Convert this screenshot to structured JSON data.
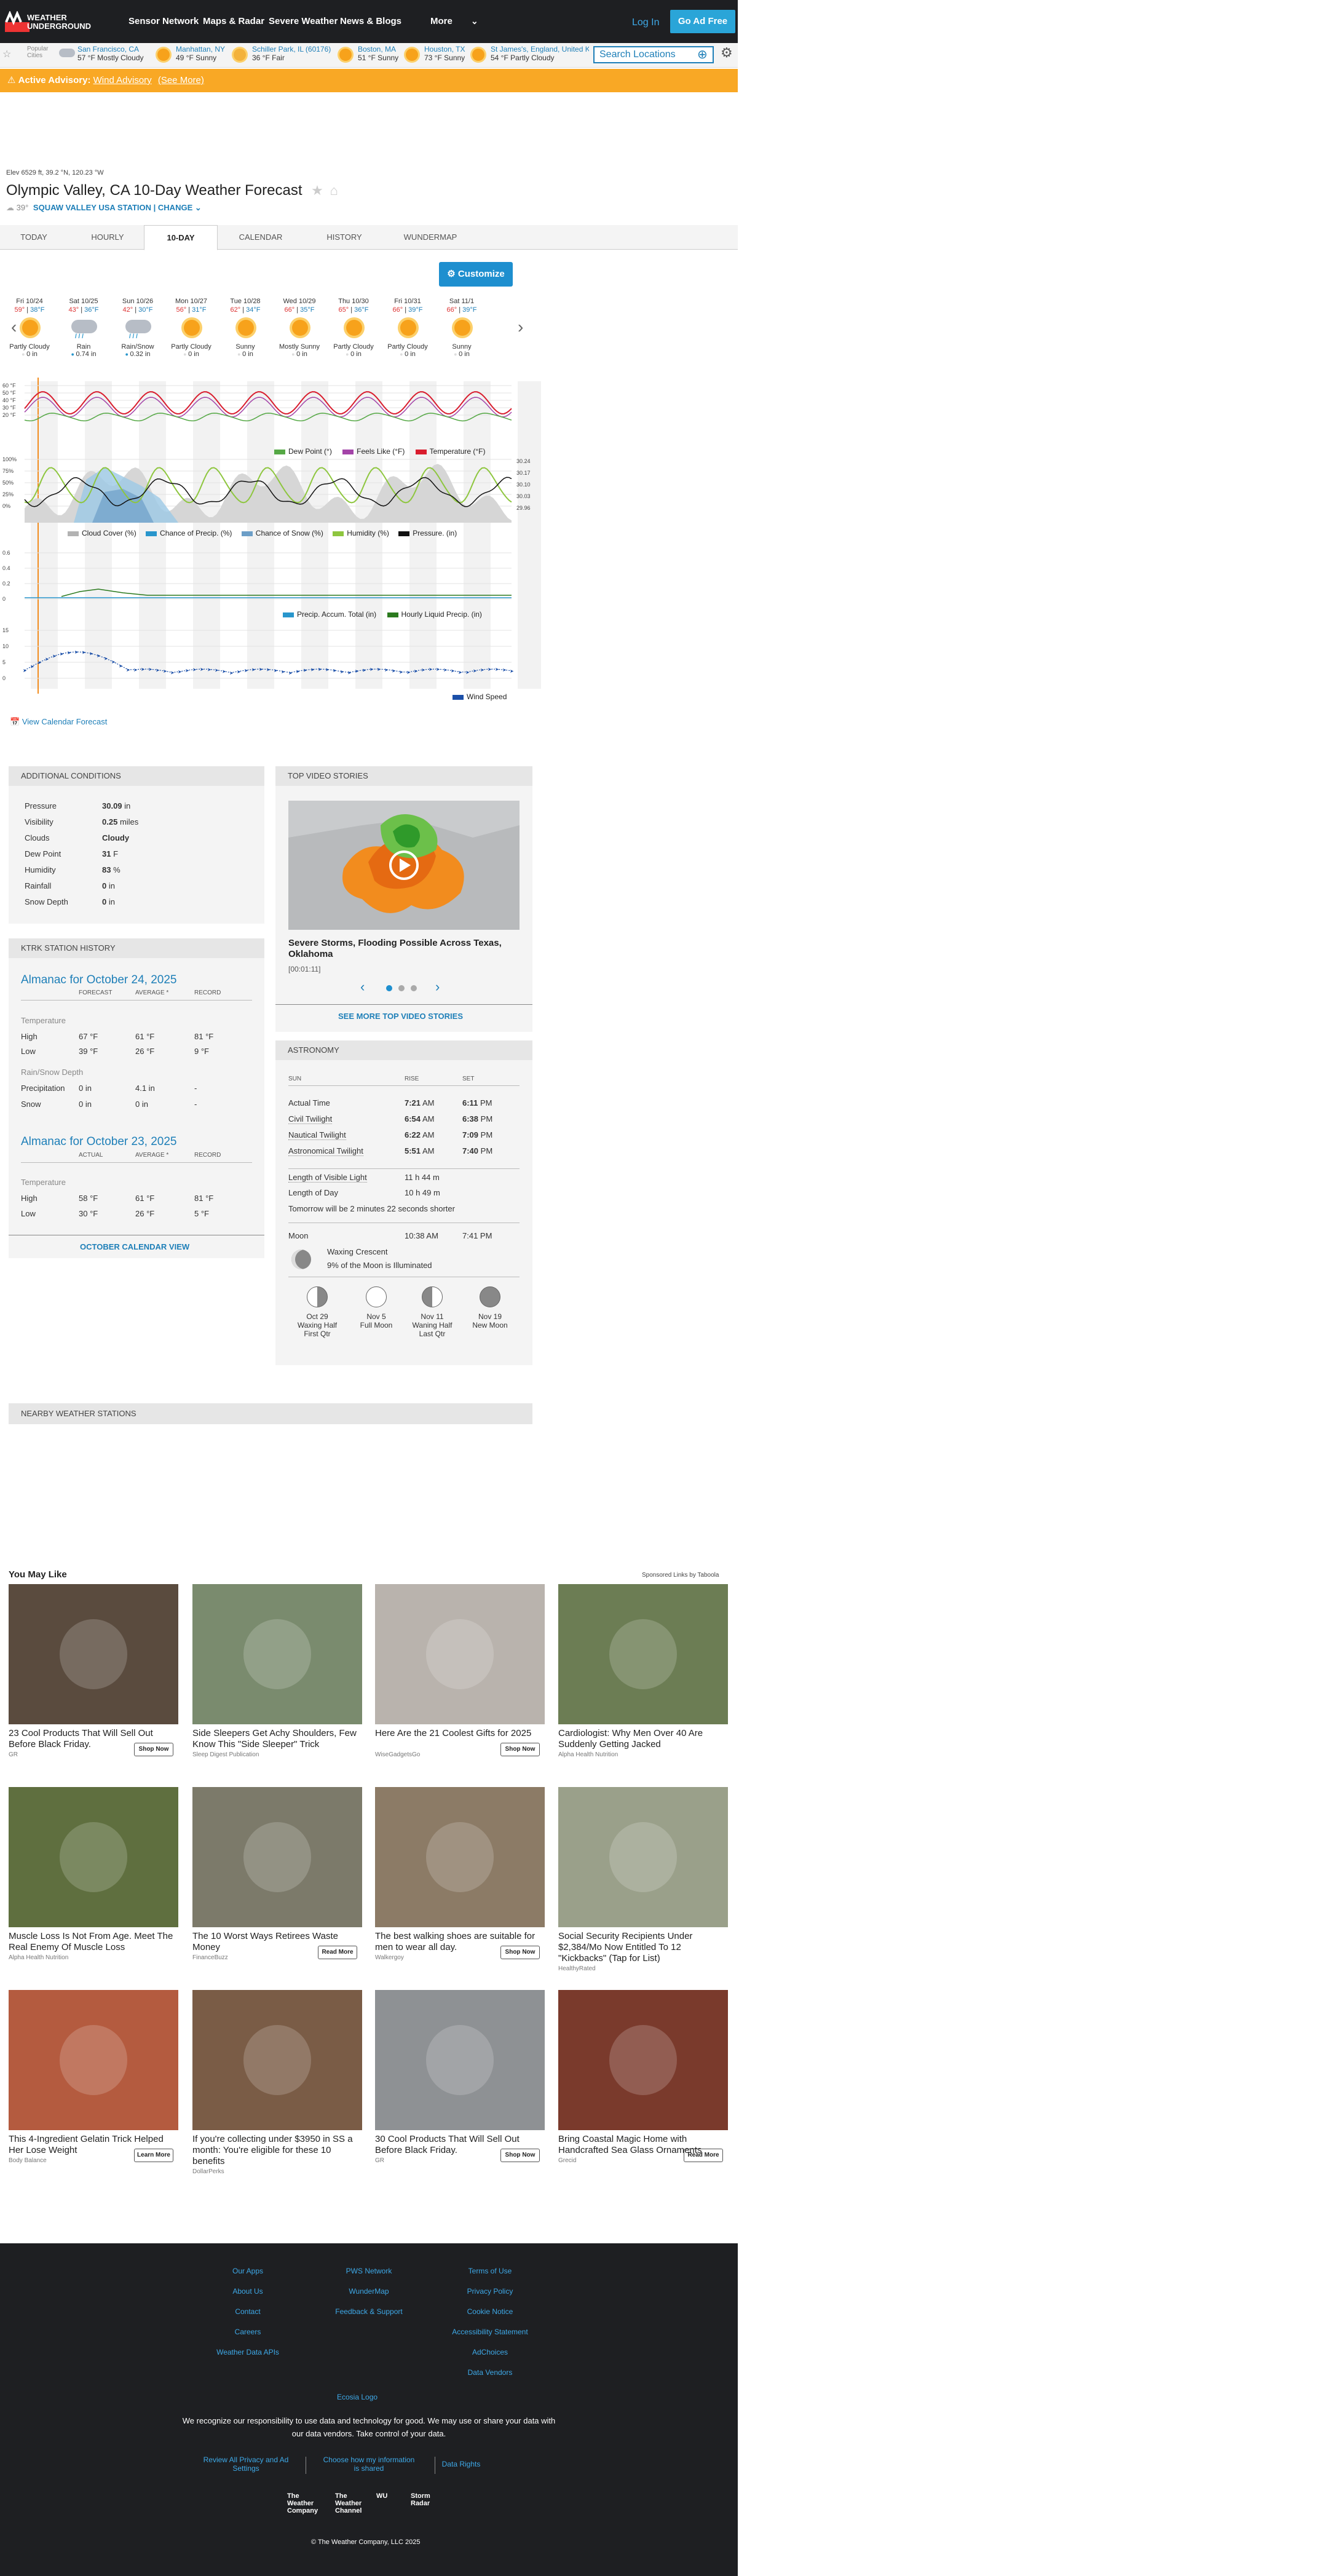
{
  "header": {
    "logo_text_1": "WEATHER",
    "logo_text_2": "UNDERGROUND",
    "nav": [
      "Sensor Network",
      "Maps & Radar",
      "Severe Weather",
      "News & Blogs",
      "More"
    ],
    "login": "Log In",
    "adfree": "Go Ad Free"
  },
  "citybar": {
    "label": "Popular Cities",
    "cities": [
      {
        "name": "San Francisco, CA",
        "temp": "57 °F Mostly Cloudy"
      },
      {
        "name": "Manhattan, NY",
        "temp": "49 °F Sunny"
      },
      {
        "name": "Schiller Park, IL (60176)",
        "temp": "36 °F Fair"
      },
      {
        "name": "Boston, MA",
        "temp": "51 °F Sunny"
      },
      {
        "name": "Houston, TX",
        "temp": "73 °F Sunny"
      },
      {
        "name": "St James's, England, United K",
        "temp": "54 °F Partly Cloudy"
      }
    ],
    "search_placeholder": "Search Locations"
  },
  "advisory": {
    "label": "Active Advisory:",
    "link": "Wind Advisory",
    "more": "(See More)"
  },
  "location": {
    "elevation": "Elev 6529 ft, 39.2 °N, 120.23 °W",
    "title": "Olympic Valley, CA 10-Day Weather Forecast",
    "current_temp": "39°",
    "station": "SQUAW VALLEY USA STATION | CHANGE"
  },
  "tabs": [
    "TODAY",
    "HOURLY",
    "10-DAY",
    "CALENDAR",
    "HISTORY",
    "WUNDERMAP"
  ],
  "customize": "Customize",
  "forecast": [
    {
      "day": "Fri 10/24",
      "hi": "59°",
      "lo": "38°F",
      "cond": "Partly Cloudy",
      "precip": "0 in",
      "icon": "sun"
    },
    {
      "day": "Sat 10/25",
      "hi": "43°",
      "lo": "36°F",
      "cond": "Rain",
      "precip": "0.74 in",
      "icon": "rain"
    },
    {
      "day": "Sun 10/26",
      "hi": "42°",
      "lo": "30°F",
      "cond": "Rain/Snow",
      "precip": "0.32 in",
      "icon": "rain"
    },
    {
      "day": "Mon 10/27",
      "hi": "56°",
      "lo": "31°F",
      "cond": "Partly Cloudy",
      "precip": "0 in",
      "icon": "sun"
    },
    {
      "day": "Tue 10/28",
      "hi": "62°",
      "lo": "34°F",
      "cond": "Sunny",
      "precip": "0 in",
      "icon": "sun"
    },
    {
      "day": "Wed 10/29",
      "hi": "66°",
      "lo": "35°F",
      "cond": "Mostly Sunny",
      "precip": "0 in",
      "icon": "sun"
    },
    {
      "day": "Thu 10/30",
      "hi": "65°",
      "lo": "36°F",
      "cond": "Partly Cloudy",
      "precip": "0 in",
      "icon": "sun"
    },
    {
      "day": "Fri 10/31",
      "hi": "66°",
      "lo": "39°F",
      "cond": "Partly Cloudy",
      "precip": "0 in",
      "icon": "sun"
    },
    {
      "day": "Sat 11/1",
      "hi": "66°",
      "lo": "39°F",
      "cond": "Sunny",
      "precip": "0 in",
      "icon": "sun"
    }
  ],
  "charts": {
    "temp_axis": [
      "60 °F",
      "50 °F",
      "40 °F",
      "30 °F",
      "20 °F"
    ],
    "legend1": [
      "Dew Point (°)",
      "Feels Like (°F)",
      "Temperature (°F)"
    ],
    "pct_axis": [
      "100%",
      "75%",
      "50%",
      "25%",
      "0%"
    ],
    "pressure_axis": [
      "30.24",
      "30.17",
      "30.10",
      "30.03",
      "29.96"
    ],
    "legend2": [
      "Cloud Cover (%)",
      "Chance of Precip. (%)",
      "Chance of Snow (%)",
      "Humidity (%)",
      "Pressure. (in)"
    ],
    "precip_axis": [
      "0.6",
      "0.4",
      "0.2",
      "0"
    ],
    "legend3": [
      "Precip. Accum. Total (in)",
      "Hourly Liquid Precip. (in)"
    ],
    "wind_axis": [
      "15",
      "10",
      "5",
      "0"
    ],
    "legend4": [
      "Wind Speed"
    ],
    "colors": {
      "temp": "#d91d2e",
      "feels": "#a344a8",
      "dew": "#55a845",
      "cloud": "#b3b3b3",
      "precip": "#2996cc",
      "snow": "#6c9ec7",
      "humidity": "#8ec63f",
      "pressure": "#111111",
      "wind": "#1b4fa8"
    }
  },
  "calendar_link": "View Calendar Forecast",
  "conditions": {
    "title": "ADDITIONAL CONDITIONS",
    "rows": [
      {
        "k": "Pressure",
        "v": "30.09",
        "u": "in"
      },
      {
        "k": "Visibility",
        "v": "0.25",
        "u": "miles"
      },
      {
        "k": "Clouds",
        "v": "Cloudy",
        "u": ""
      },
      {
        "k": "Dew Point",
        "v": "31",
        "u": "F"
      },
      {
        "k": "Humidity",
        "v": "83",
        "u": "%"
      },
      {
        "k": "Rainfall",
        "v": "0",
        "u": "in"
      },
      {
        "k": "Snow Depth",
        "v": "0",
        "u": "in"
      }
    ]
  },
  "history": {
    "title": "KTRK STATION HISTORY",
    "almanac1": "Almanac for October 24, 2025",
    "cols1": [
      "FORECAST",
      "AVERAGE *",
      "RECORD"
    ],
    "temp_label": "Temperature",
    "high": [
      "High",
      "67 °F",
      "61 °F",
      "81 °F"
    ],
    "low": [
      "Low",
      "39 °F",
      "26 °F",
      "9 °F"
    ],
    "rs_label": "Rain/Snow Depth",
    "precip": [
      "Precipitation",
      "0 in",
      "4.1 in",
      "-"
    ],
    "snow": [
      "Snow",
      "0 in",
      "0 in",
      "-"
    ],
    "almanac2": "Almanac for October 23, 2025",
    "cols2": [
      "ACTUAL",
      "AVERAGE *",
      "RECORD"
    ],
    "high2": [
      "High",
      "58 °F",
      "61 °F",
      "81 °F"
    ],
    "low2": [
      "Low",
      "30 °F",
      "26 °F",
      "5 °F"
    ],
    "calendar_view": "OCTOBER CALENDAR VIEW"
  },
  "video": {
    "title": "TOP VIDEO STORIES",
    "headline": "Severe Storms, Flooding Possible Across Texas, Oklahoma",
    "duration": "[00:01:11]",
    "see_more": "SEE MORE TOP VIDEO STORIES"
  },
  "astronomy": {
    "title": "ASTRONOMY",
    "cols": [
      "SUN",
      "RISE",
      "SET"
    ],
    "rows": [
      {
        "k": "Actual Time",
        "r": "7:21",
        "rp": "AM",
        "s": "6:11",
        "sp": "PM"
      },
      {
        "k": "Civil Twilight",
        "r": "6:54",
        "rp": "AM",
        "s": "6:38",
        "sp": "PM"
      },
      {
        "k": "Nautical Twilight",
        "r": "6:22",
        "rp": "AM",
        "s": "7:09",
        "sp": "PM"
      },
      {
        "k": "Astronomical Twilight",
        "r": "5:51",
        "rp": "AM",
        "s": "7:40",
        "sp": "PM"
      }
    ],
    "visible": "Length of Visible Light",
    "visible_v": "11 h 44 m",
    "day": "Length of Day",
    "day_v": "10 h 49 m",
    "tomorrow": "Tomorrow will be 2 minutes 22 seconds shorter",
    "moon": "Moon",
    "moon_r": "10:38 AM",
    "moon_s": "7:41 PM",
    "phase": "Waxing Crescent",
    "illum": "9% of the Moon is Illuminated",
    "phases": [
      {
        "date": "Oct 29",
        "name1": "Waxing Half",
        "name2": "First Qtr"
      },
      {
        "date": "Nov 5",
        "name1": "Full Moon",
        "name2": ""
      },
      {
        "date": "Nov 11",
        "name1": "Waning Half",
        "name2": "Last Qtr"
      },
      {
        "date": "Nov 19",
        "name1": "New Moon",
        "name2": ""
      }
    ]
  },
  "nearby": "NEARBY WEATHER STATIONS",
  "ads": {
    "heading": "You May Like",
    "sponsor": "Sponsored Links by Taboola",
    "items": [
      {
        "title": "23 Cool Products That Will Sell Out Before Black Friday.",
        "src": "GR",
        "btn": "Shop Now",
        "bg": "#5a4b3e"
      },
      {
        "title": "Side Sleepers Get Achy Shoulders, Few Know This \"Side Sleeper\" Trick",
        "src": "Sleep Digest Publication",
        "btn": "",
        "bg": "#7a8b6e"
      },
      {
        "title": "Here Are the 21 Coolest Gifts for 2025",
        "src": "WiseGadgetsGo",
        "btn": "Shop Now",
        "bg": "#b9b3ad"
      },
      {
        "title": "Cardiologist: Why Men Over 40 Are Suddenly Getting Jacked",
        "src": "Alpha Health Nutrition",
        "btn": "",
        "bg": "#6c7d54"
      },
      {
        "title": "Muscle Loss Is Not From Age. Meet The Real Enemy Of Muscle Loss",
        "src": "Alpha Health Nutrition",
        "btn": "",
        "bg": "#5f6f3f"
      },
      {
        "title": "The 10 Worst Ways Retirees Waste Money",
        "src": "FinanceBuzz",
        "btn": "Read More",
        "bg": "#7c7a6a"
      },
      {
        "title": "The best walking shoes are suitable for men to wear all day.",
        "src": "Walkergoy",
        "btn": "Shop Now",
        "bg": "#8c7b66"
      },
      {
        "title": "Social Security Recipients Under $2,384/Mo Now Entitled To 12 \"Kickbacks\" (Tap for List)",
        "src": "HealthyRated",
        "btn": "",
        "bg": "#9aa08a"
      },
      {
        "title": "This 4-Ingredient Gelatin Trick Helped Her Lose Weight",
        "src": "Body Balance",
        "btn": "Learn More",
        "bg": "#b45b3f"
      },
      {
        "title": "If you're collecting under $3950 in SS a month: You're eligible for these 10 benefits",
        "src": "DollarPerks",
        "btn": "",
        "bg": "#7a5c46"
      },
      {
        "title": "30 Cool Products That Will Sell Out Before Black Friday.",
        "src": "GR",
        "btn": "Shop Now",
        "bg": "#8e9194"
      },
      {
        "title": "Bring Coastal Magic Home with Handcrafted Sea Glass Ornaments",
        "src": "Grecid",
        "btn": "Read More",
        "bg": "#7a3a2c"
      }
    ]
  },
  "footer": {
    "col1": [
      "Our Apps",
      "About Us",
      "Contact",
      "Careers",
      "Weather Data APIs"
    ],
    "col2": [
      "PWS Network",
      "WunderMap",
      "Feedback & Support"
    ],
    "col3": [
      "Terms of Use",
      "Privacy Policy",
      "Cookie Notice",
      "Accessibility Statement",
      "AdChoices",
      "Data Vendors"
    ],
    "ecoimg": "Ecosia Logo",
    "statement": "We recognize our responsibility to use data and technology for good. We may use or share your data with our data vendors. Take control of your data.",
    "privacy": [
      "Review All Privacy and Ad Settings",
      "Choose how my information is shared",
      "Data Rights"
    ],
    "brands": [
      "The Weather Company",
      "The Weather Channel",
      "WU",
      "Storm Radar"
    ],
    "copyright": "© The Weather Company, LLC 2025"
  }
}
